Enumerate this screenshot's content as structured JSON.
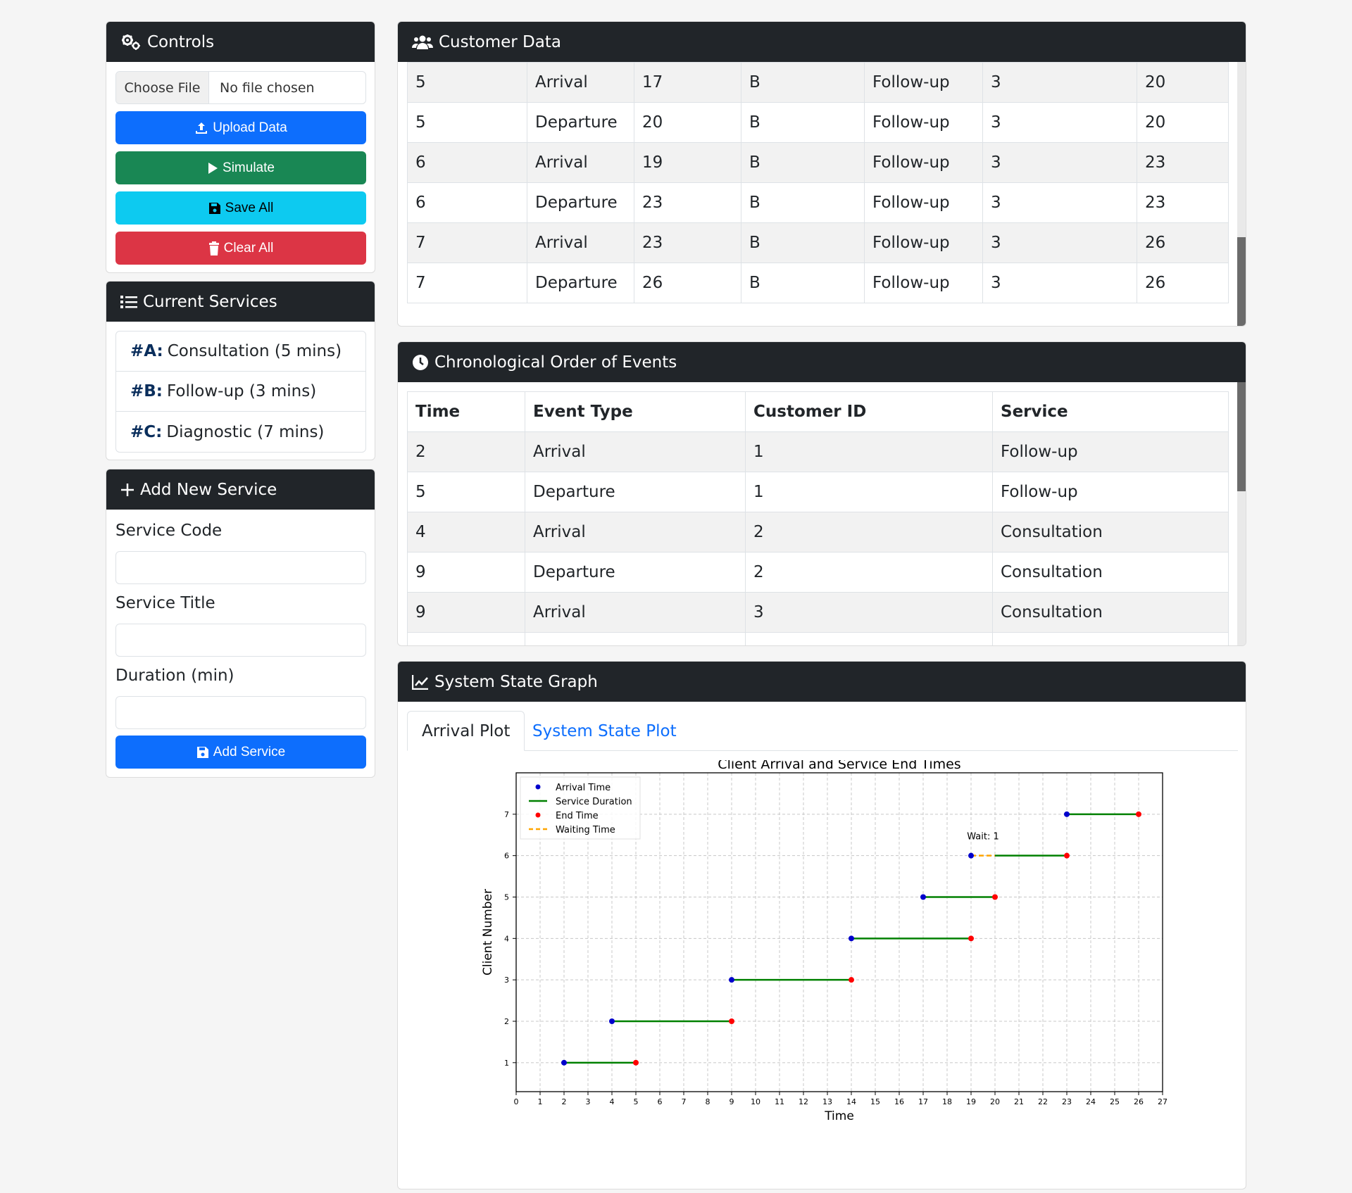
{
  "controls": {
    "title": "Controls",
    "choose_file": "Choose File",
    "no_file": "No file chosen",
    "upload": "Upload Data",
    "simulate": "Simulate",
    "save": "Save All",
    "clear": "Clear All"
  },
  "services": {
    "title": "Current Services",
    "items": [
      {
        "code": "#A:",
        "label": "Consultation (5 mins)"
      },
      {
        "code": "#B:",
        "label": "Follow-up (3 mins)"
      },
      {
        "code": "#C:",
        "label": "Diagnostic (7 mins)"
      }
    ]
  },
  "add_service": {
    "title": "Add New Service",
    "code_label": "Service Code",
    "title_label": "Service Title",
    "duration_label": "Duration (min)",
    "submit": "Add Service"
  },
  "customer": {
    "title": "Customer Data",
    "rows": [
      [
        "5",
        "Arrival",
        "17",
        "B",
        "Follow-up",
        "3",
        "20"
      ],
      [
        "5",
        "Departure",
        "20",
        "B",
        "Follow-up",
        "3",
        "20"
      ],
      [
        "6",
        "Arrival",
        "19",
        "B",
        "Follow-up",
        "3",
        "23"
      ],
      [
        "6",
        "Departure",
        "23",
        "B",
        "Follow-up",
        "3",
        "23"
      ],
      [
        "7",
        "Arrival",
        "23",
        "B",
        "Follow-up",
        "3",
        "26"
      ],
      [
        "7",
        "Departure",
        "26",
        "B",
        "Follow-up",
        "3",
        "26"
      ]
    ]
  },
  "chrono": {
    "title": "Chronological Order of Events",
    "headers": [
      "Time",
      "Event Type",
      "Customer ID",
      "Service"
    ],
    "rows": [
      [
        "2",
        "Arrival",
        "1",
        "Follow-up"
      ],
      [
        "5",
        "Departure",
        "1",
        "Follow-up"
      ],
      [
        "4",
        "Arrival",
        "2",
        "Consultation"
      ],
      [
        "9",
        "Departure",
        "2",
        "Consultation"
      ],
      [
        "9",
        "Arrival",
        "3",
        "Consultation"
      ]
    ]
  },
  "graph": {
    "title": "System State Graph",
    "tabs": [
      "Arrival Plot",
      "System State Plot"
    ]
  },
  "chart_data": {
    "type": "scatter",
    "title": "Client Arrival and Service End Times",
    "xlabel": "Time",
    "ylabel": "Client Number",
    "xlim": [
      0,
      27
    ],
    "ylim": [
      0.3,
      8.0
    ],
    "xticks": [
      0,
      1,
      2,
      3,
      4,
      5,
      6,
      7,
      8,
      9,
      10,
      11,
      12,
      13,
      14,
      15,
      16,
      17,
      18,
      19,
      20,
      21,
      22,
      23,
      24,
      25,
      26,
      27
    ],
    "yticks": [
      1,
      2,
      3,
      4,
      5,
      6,
      7
    ],
    "grid": true,
    "legend_position": "top-left",
    "legend": [
      "Arrival Time",
      "Service Duration",
      "End Time",
      "Waiting Time"
    ],
    "colors": {
      "arrival": "#0000cc",
      "service": "#008000",
      "end": "#ff0000",
      "wait": "#ffa500"
    },
    "clients": [
      {
        "client": 1,
        "arrival": 2,
        "start": 2,
        "end": 5
      },
      {
        "client": 2,
        "arrival": 4,
        "start": 4,
        "end": 9
      },
      {
        "client": 3,
        "arrival": 9,
        "start": 9,
        "end": 14
      },
      {
        "client": 4,
        "arrival": 14,
        "start": 14,
        "end": 19
      },
      {
        "client": 5,
        "arrival": 17,
        "start": 17,
        "end": 20
      },
      {
        "client": 6,
        "arrival": 19,
        "start": 20,
        "end": 23
      },
      {
        "client": 7,
        "arrival": 23,
        "start": 23,
        "end": 26
      }
    ],
    "annotations": [
      {
        "client": 6,
        "x": 19,
        "text": "Wait: 1"
      }
    ]
  }
}
